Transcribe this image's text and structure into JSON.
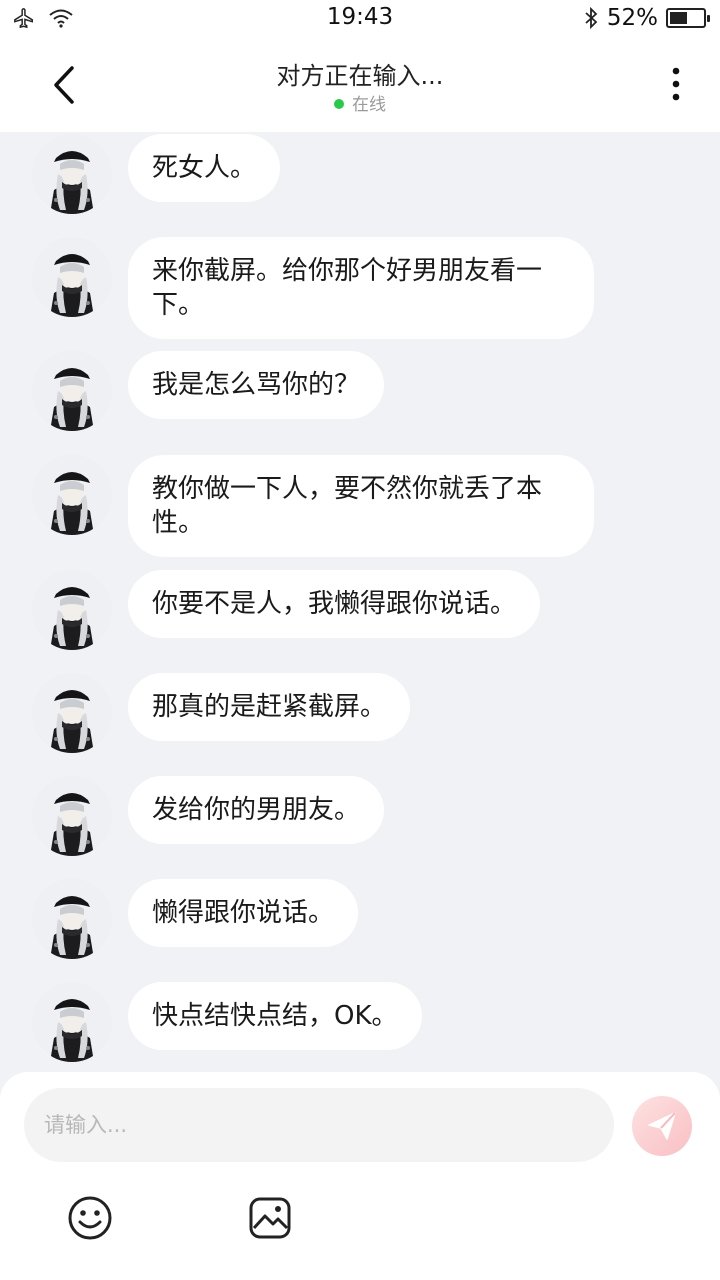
{
  "status_bar": {
    "time": "19:43",
    "battery_text": "52%",
    "battery_level": 0.52,
    "icons": [
      "airplane-icon",
      "wifi-icon",
      "bluetooth-icon",
      "battery-icon"
    ]
  },
  "header": {
    "title": "对方正在输入...",
    "status": "在线",
    "online_color": "#2ac94a",
    "icons": [
      "back-icon",
      "more-icon"
    ]
  },
  "messages": [
    {
      "text": "死女人。"
    },
    {
      "text": "来你截屏。给你那个好男朋友看一下。"
    },
    {
      "text": "我是怎么骂你的？"
    },
    {
      "text": "教你做一下人，要不然你就丢了本性。"
    },
    {
      "text": "你要不是人，我懒得跟你说话。"
    },
    {
      "text": "那真的是赶紧截屏。"
    },
    {
      "text": "发给你的男朋友。"
    },
    {
      "text": "懒得跟你说话。"
    },
    {
      "text": "快点结快点结，OK。"
    }
  ],
  "composer": {
    "placeholder": "请输入...",
    "icons": [
      "send-icon",
      "emoji-icon",
      "image-icon"
    ]
  }
}
